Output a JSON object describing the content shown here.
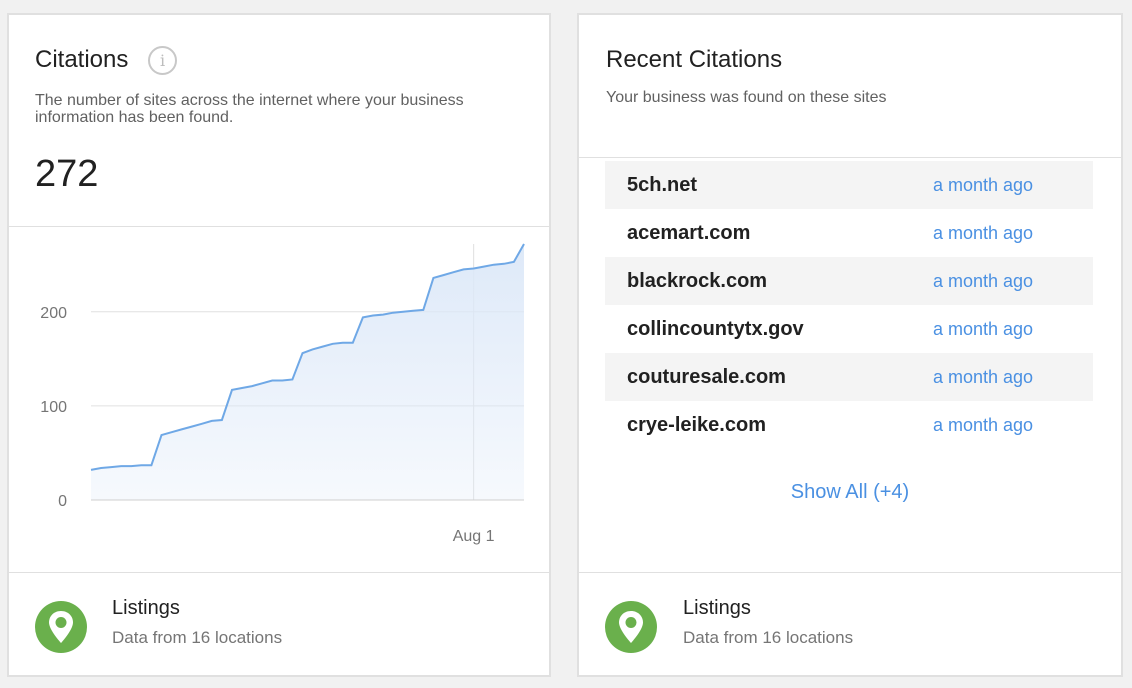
{
  "citations_card": {
    "title": "Citations",
    "description": "The number of sites across the internet where your business information has been found.",
    "total": "272",
    "footer": {
      "title": "Listings",
      "subtitle": "Data from 16 locations"
    }
  },
  "chart_data": {
    "type": "area",
    "title": "",
    "xlabel": "",
    "ylabel": "",
    "ylim": [
      0,
      272
    ],
    "yticks": [
      0,
      100,
      200
    ],
    "x_tick_label": "Aug 1",
    "x_tick_index": 38,
    "grid": true,
    "legend": "none",
    "line_color": "#6fa8e6",
    "fill_color": "#dce8f8",
    "values": [
      32,
      34,
      35,
      36,
      36,
      37,
      37,
      69,
      72,
      75,
      78,
      81,
      84,
      85,
      117,
      119,
      121,
      124,
      127,
      127,
      128,
      156,
      160,
      163,
      166,
      167,
      167,
      194,
      196,
      197,
      199,
      200,
      201,
      202,
      236,
      239,
      242,
      245,
      246,
      248,
      250,
      251,
      253,
      272
    ]
  },
  "recent_card": {
    "title": "Recent Citations",
    "description": "Your business was found on these sites",
    "items": [
      {
        "site": "5ch.net",
        "time": "a month ago"
      },
      {
        "site": "acemart.com",
        "time": "a month ago"
      },
      {
        "site": "blackrock.com",
        "time": "a month ago"
      },
      {
        "site": "collincountytx.gov",
        "time": "a month ago"
      },
      {
        "site": "couturesale.com",
        "time": "a month ago"
      },
      {
        "site": "crye-leike.com",
        "time": "a month ago"
      }
    ],
    "show_all": "Show All (+4)",
    "footer": {
      "title": "Listings",
      "subtitle": "Data from 16 locations"
    }
  },
  "colors": {
    "accent": "#4a90e2",
    "listings_green": "#6ab04c"
  },
  "icons": {
    "info": "info-icon",
    "listings": "map-pin-icon"
  }
}
